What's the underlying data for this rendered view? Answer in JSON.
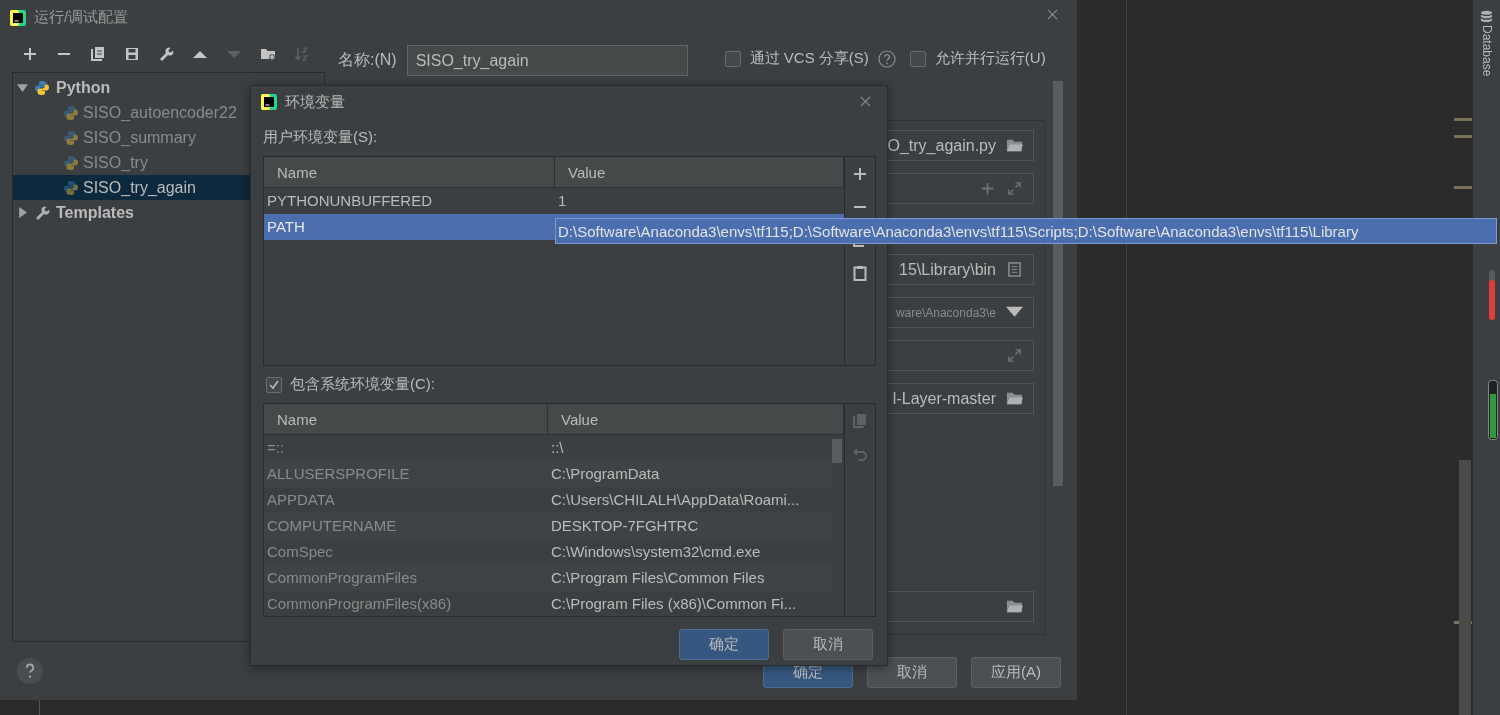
{
  "window": {
    "title": "运行/调试配置"
  },
  "toolbar": [
    {
      "kind": "add",
      "disabled": false
    },
    {
      "kind": "remove",
      "disabled": false
    },
    {
      "kind": "copy",
      "disabled": false
    },
    {
      "kind": "save",
      "disabled": false
    },
    {
      "kind": "wrench",
      "disabled": false
    },
    {
      "kind": "up",
      "disabled": false
    },
    {
      "kind": "down",
      "disabled": true
    },
    {
      "kind": "folder",
      "disabled": false
    },
    {
      "kind": "sort",
      "disabled": true
    }
  ],
  "tree": [
    {
      "label": "Python",
      "kind": "python",
      "expanded": true,
      "selected": false,
      "children": [
        {
          "label": "SISO_autoencoder22",
          "selected": false
        },
        {
          "label": "SISO_summary",
          "selected": false
        },
        {
          "label": "SISO_try",
          "selected": false
        },
        {
          "label": "SISO_try_again",
          "selected": true
        }
      ]
    },
    {
      "label": "Templates",
      "kind": "wrench",
      "expanded": false,
      "selected": false
    }
  ],
  "name_field": {
    "label": "名称:(N)",
    "value": "SISO_try_again"
  },
  "options": [
    {
      "label": "通过 VCS 分享(S)",
      "checked": false,
      "help": true
    },
    {
      "label": "允许并行运行(U)",
      "checked": false,
      "help": false
    }
  ],
  "config_fields": [
    {
      "kind": "folder",
      "value": "O_try_again.py"
    },
    {
      "kind": "add-expand"
    },
    {
      "kind": "document",
      "value": "15\\Library\\bin"
    },
    {
      "kind": "dropdown",
      "value": "ware\\Anaconda3\\e"
    },
    {
      "kind": "expand"
    },
    {
      "kind": "folder",
      "value": "l-Layer-master"
    },
    {
      "kind": "folder"
    }
  ],
  "footer_buttons": [
    {
      "label": "确定",
      "primary": true
    },
    {
      "label": "取消",
      "primary": false
    },
    {
      "label": "应用(A)",
      "primary": false
    }
  ],
  "env_dialog": {
    "title": "环境变量",
    "user_label": "用户环境变量(S):",
    "user_table": {
      "columns": [
        "Name",
        "Value"
      ],
      "rows": [
        {
          "name": "PYTHONUNBUFFERED",
          "value": "1",
          "selected": false
        },
        {
          "name": "PATH",
          "value": "D:\\Software\\Anaconda3\\envs\\tf115;D:\\Software\\Anaconda3\\envs\\tf115\\Scripts;D:\\Software\\Anaconda3\\envs\\tf115\\Library",
          "selected": true
        }
      ]
    },
    "include_system": {
      "label": "包含系统环境变量(C):",
      "checked": true
    },
    "system_table": {
      "columns": [
        "Name",
        "Value"
      ],
      "rows": [
        {
          "name": "=::",
          "value": "::\\"
        },
        {
          "name": "ALLUSERSPROFILE",
          "value": "C:\\ProgramData"
        },
        {
          "name": "APPDATA",
          "value": "C:\\Users\\CHILALH\\AppData\\Roami..."
        },
        {
          "name": "COMPUTERNAME",
          "value": "DESKTOP-7FGHTRC"
        },
        {
          "name": "ComSpec",
          "value": "C:\\Windows\\system32\\cmd.exe"
        },
        {
          "name": "CommonProgramFiles",
          "value": "C:\\Program Files\\Common Files"
        },
        {
          "name": "CommonProgramFiles(x86)",
          "value": "C:\\Program Files (x86)\\Common Fi..."
        }
      ]
    },
    "buttons": [
      {
        "label": "确定",
        "primary": true
      },
      {
        "label": "取消",
        "primary": false
      }
    ]
  },
  "side_strip": {
    "label": "Database"
  }
}
